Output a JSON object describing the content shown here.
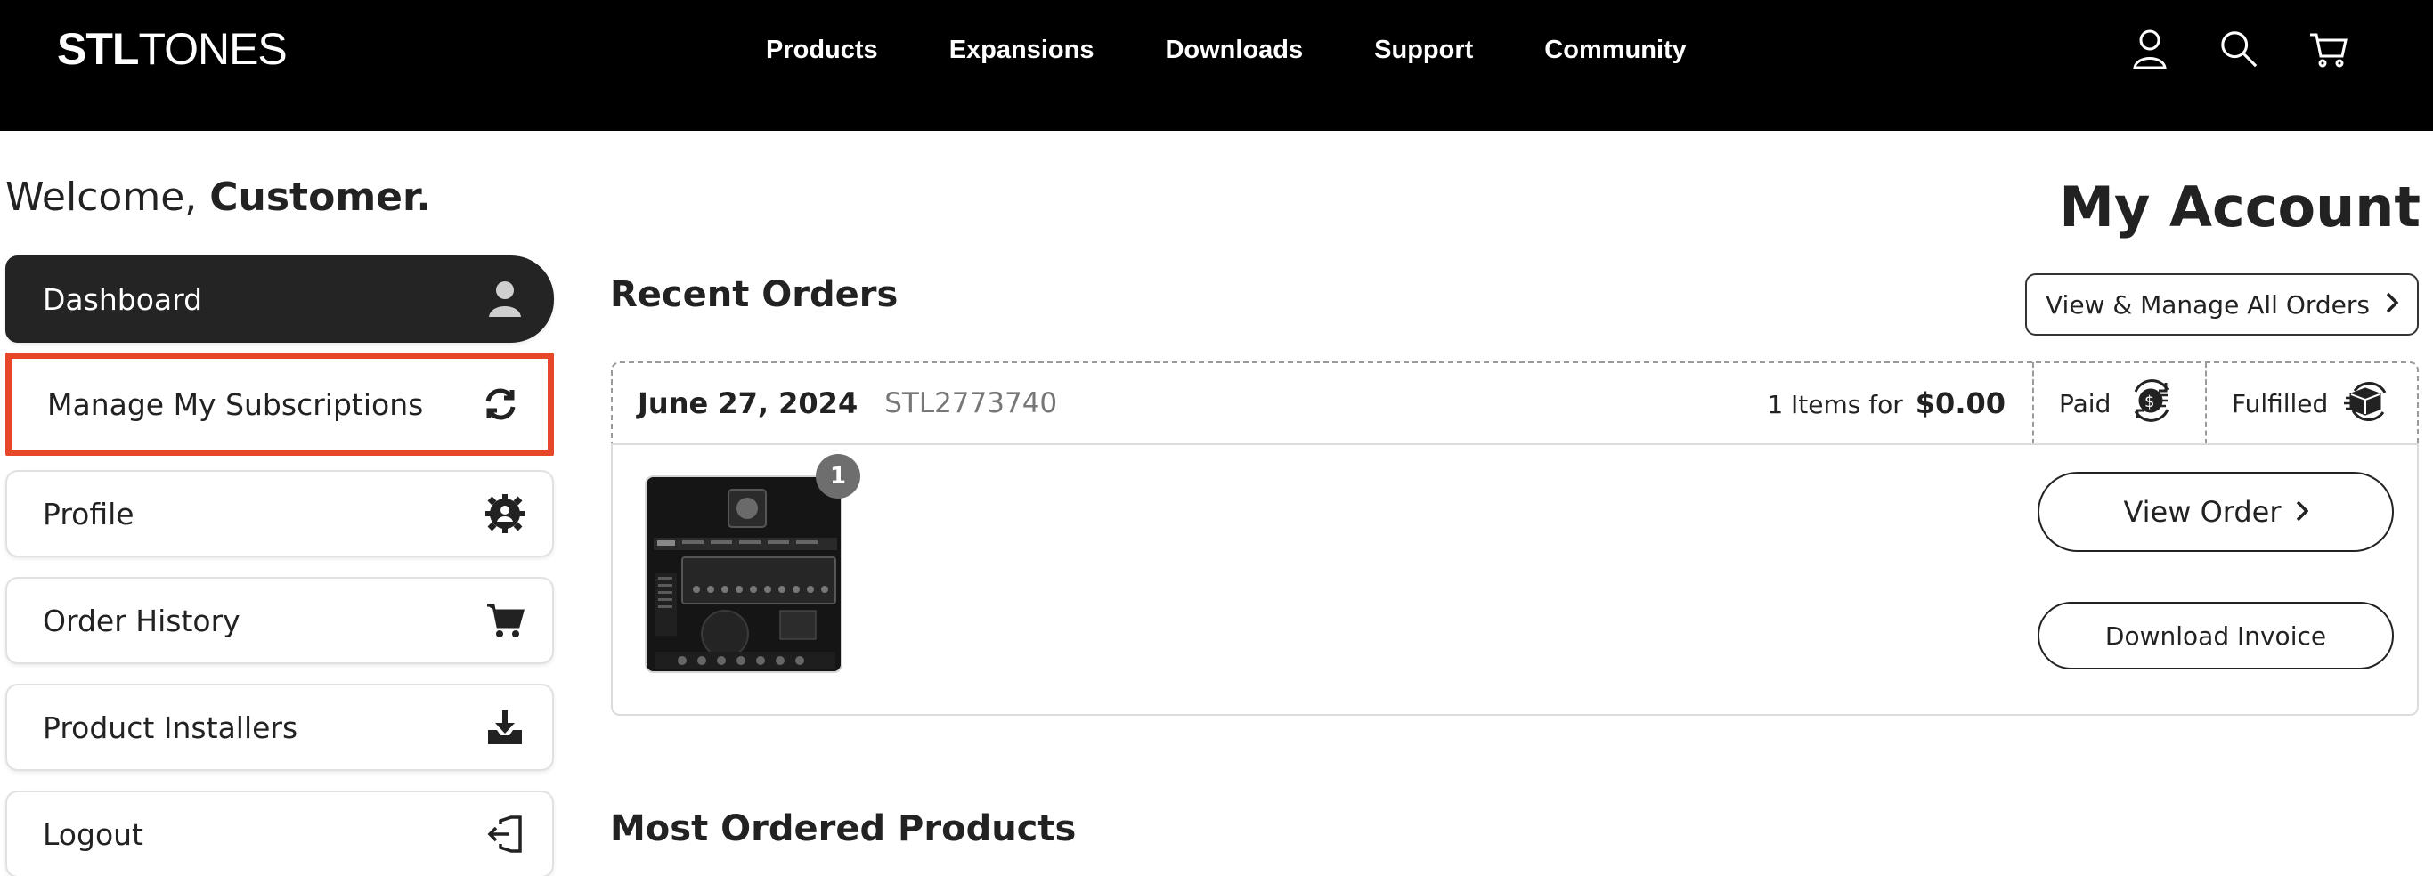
{
  "brand": {
    "logo_strong": "STL",
    "logo_thin": "TONES"
  },
  "nav": {
    "items": [
      "Products",
      "Expansions",
      "Downloads",
      "Support",
      "Community"
    ],
    "icons": [
      "user-icon",
      "search-icon",
      "cart-icon"
    ]
  },
  "welcome": {
    "prefix": "Welcome, ",
    "name": "Customer."
  },
  "sidebar": {
    "items": [
      {
        "label": "Dashboard",
        "icon": "user-avatar-icon",
        "state": "active"
      },
      {
        "label": "Manage My Subscriptions",
        "icon": "refresh-icon",
        "state": "highlighted"
      },
      {
        "label": "Profile",
        "icon": "user-gear-icon",
        "state": "normal"
      },
      {
        "label": "Order History",
        "icon": "cart-icon",
        "state": "normal"
      },
      {
        "label": "Product Installers",
        "icon": "download-tray-icon",
        "state": "normal"
      },
      {
        "label": "Logout",
        "icon": "logout-icon",
        "state": "normal"
      }
    ]
  },
  "main": {
    "page_title": "My Account",
    "recent_orders_title": "Recent Orders",
    "view_all_label": "View & Manage All Orders",
    "most_ordered_title": "Most Ordered Products"
  },
  "order": {
    "date": "June 27, 2024",
    "number": "STL2773740",
    "items_text": "1 Items for",
    "total": "$0.00",
    "payment_status": "Paid",
    "fulfillment_status": "Fulfilled",
    "item_count_badge": "1",
    "view_order_label": "View Order",
    "download_invoice_label": "Download Invoice"
  },
  "colors": {
    "topbar": "#000000",
    "active_item": "#242424",
    "highlight": "#e54728"
  }
}
